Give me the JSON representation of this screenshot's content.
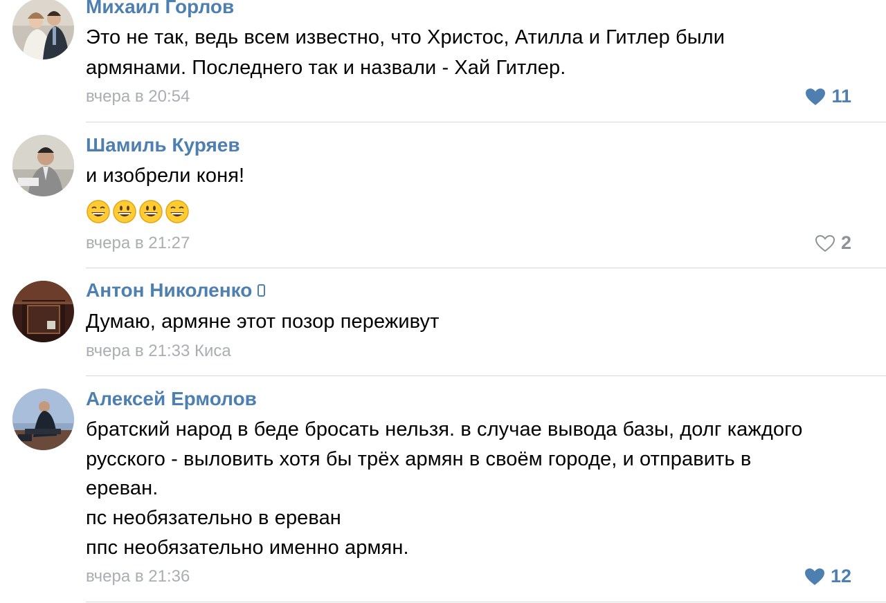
{
  "comments": [
    {
      "author": "Михаил Горлов",
      "lines": [
        "Это не так, ведь всем известно, что Христос, Атилла и Гитлер были",
        "армянами. Последнего так и назвали - Хай Гитлер."
      ],
      "time": "вчера в 20:54",
      "likes": "11",
      "liked": true
    },
    {
      "author": "Шамиль Куряев",
      "lines": [
        "и изобрели коня!"
      ],
      "emojis": [
        "grinning-face-icon",
        "smiling-face-icon",
        "smiling-face-icon",
        "grinning-face-icon"
      ],
      "time": "вчера в 21:27",
      "likes": "2",
      "liked": false
    },
    {
      "author": "Антон Николенко",
      "author_icon": "mobile-phone-icon",
      "lines": [
        "Думаю, армяне этот позор переживут"
      ],
      "time": "вчера в 21:33 Киса",
      "likes": "",
      "liked": false
    },
    {
      "author": "Алексей Ермолов",
      "lines": [
        "братский народ в беде бросать нельзя. в случае вывода базы, долг каждого",
        "русского - выловить хотя бы трёх армян в своём городе, и отправить в",
        "ереван.",
        "пс необязательно в ереван",
        "ппс необязательно именно армян."
      ],
      "time": "вчера в 21:36",
      "likes": "12",
      "liked": true
    }
  ],
  "colors": {
    "author": "#4d7fb0",
    "meta": "#aaaeb3",
    "like_active": "#4d7fb0",
    "like_inactive": "#8e9297",
    "divider": "#d7d8da"
  }
}
